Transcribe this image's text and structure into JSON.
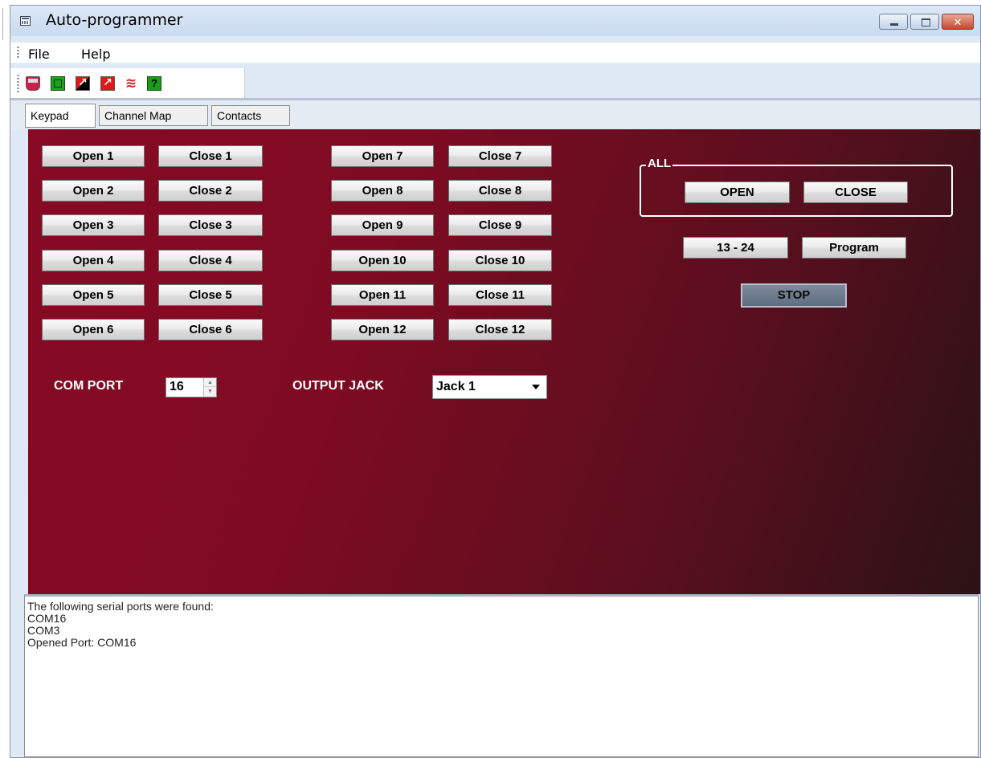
{
  "window": {
    "title": "Auto-programmer"
  },
  "menu": {
    "file": "File",
    "help": "Help"
  },
  "toolbar": {
    "icons": [
      "device-icon",
      "green-square-icon",
      "red-black-arrow-icon",
      "red-arrow-icon",
      "signal-waves-icon",
      "help-icon"
    ],
    "help_glyph": "?"
  },
  "tabs": [
    {
      "label": "Keypad",
      "active": true
    },
    {
      "label": "Channel Map",
      "active": false
    },
    {
      "label": "Contacts",
      "active": false
    }
  ],
  "keypad": {
    "open_buttons": [
      "Open 1",
      "Open 2",
      "Open 3",
      "Open 4",
      "Open 5",
      "Open 6",
      "Open 7",
      "Open 8",
      "Open 9",
      "Open 10",
      "Open 11",
      "Open 12"
    ],
    "close_buttons": [
      "Close 1",
      "Close 2",
      "Close 3",
      "Close 4",
      "Close 5",
      "Close 6",
      "Close 7",
      "Close 8",
      "Close 9",
      "Close 10",
      "Close 11",
      "Close 12"
    ],
    "all_group": {
      "label": "ALL",
      "open": "OPEN",
      "close": "CLOSE"
    },
    "range_button": "13 - 24",
    "program_button": "Program",
    "stop_button": "STOP",
    "com_port": {
      "label": "COM PORT",
      "value": "16"
    },
    "output_jack": {
      "label": "OUTPUT JACK",
      "value": "Jack 1"
    }
  },
  "log": {
    "lines": [
      "The following serial ports were found:",
      "COM16",
      "COM3",
      "Opened Port: COM16"
    ]
  },
  "colors": {
    "panel_start": "#880a24",
    "panel_end": "#2a1216",
    "stop_button": "#6a788a"
  }
}
